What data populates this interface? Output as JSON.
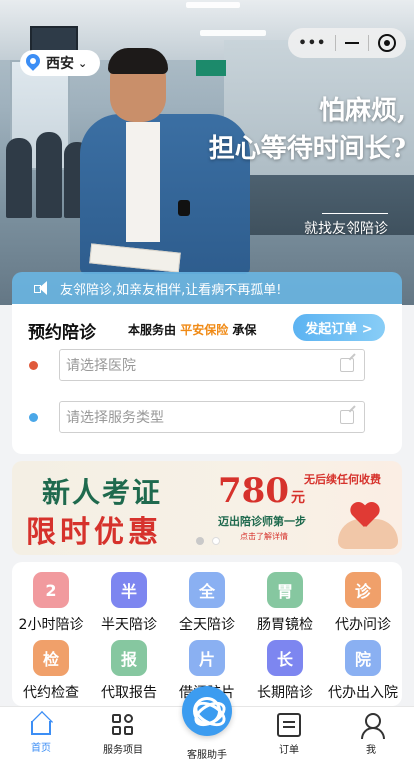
{
  "location": {
    "city": "西安"
  },
  "hero": {
    "title_line1": "怕麻烦,",
    "title_line2": "担心等待时间长?",
    "subtitle": "就找友邻陪诊"
  },
  "notice": {
    "text": "友邻陪诊,如亲友相伴,让看病不再孤单!"
  },
  "booking": {
    "title": "预约陪诊",
    "insurance_prefix": "本服务由",
    "insurance_name": "平安保险",
    "insurance_suffix": "承保",
    "order_button": "发起订单 >",
    "hospital_placeholder": "请选择医院",
    "service_placeholder": "请选择服务类型"
  },
  "banner": {
    "line1": "新人考证",
    "line2": "限时优惠",
    "no_fee": "无后续任何收费",
    "price": "780",
    "price_unit": "元",
    "step": "迈出陪诊师第一步",
    "detail": "点击了解详情",
    "pager_count": 2,
    "pager_active": 2
  },
  "services": [
    {
      "label": "2小时陪诊",
      "icon": "clock-2h-icon",
      "glyph": "2",
      "color": "#f19a9e"
    },
    {
      "label": "半天陪诊",
      "icon": "half-day-icon",
      "glyph": "半",
      "color": "#7d86f0"
    },
    {
      "label": "全天陪诊",
      "icon": "full-day-icon",
      "glyph": "全",
      "color": "#8ab0f2"
    },
    {
      "label": "肠胃镜检",
      "icon": "stomach-icon",
      "glyph": "胃",
      "color": "#86c7a0"
    },
    {
      "label": "代办问诊",
      "icon": "building-icon",
      "glyph": "诊",
      "color": "#f0a06a"
    },
    {
      "label": "代约检查",
      "icon": "stethoscope-icon",
      "glyph": "检",
      "color": "#f0a06a"
    },
    {
      "label": "代取报告",
      "icon": "report-icon",
      "glyph": "报",
      "color": "#86c7a0"
    },
    {
      "label": "借阅胶片",
      "icon": "film-icon",
      "glyph": "片",
      "color": "#8ab0f2"
    },
    {
      "label": "长期陪诊",
      "icon": "long-term-icon",
      "glyph": "长",
      "color": "#7d86f0"
    },
    {
      "label": "代办出入院",
      "icon": "hospital-icon",
      "glyph": "院",
      "color": "#8ab0f2"
    }
  ],
  "tabs": {
    "home": "首页",
    "services": "服务项目",
    "assistant": "客服助手",
    "orders": "订单",
    "me": "我"
  },
  "colors": {
    "accent": "#3c8ef5",
    "insurance": "#f08a15",
    "dot_hospital": "#e05a3c",
    "dot_service": "#4aa7e8"
  }
}
